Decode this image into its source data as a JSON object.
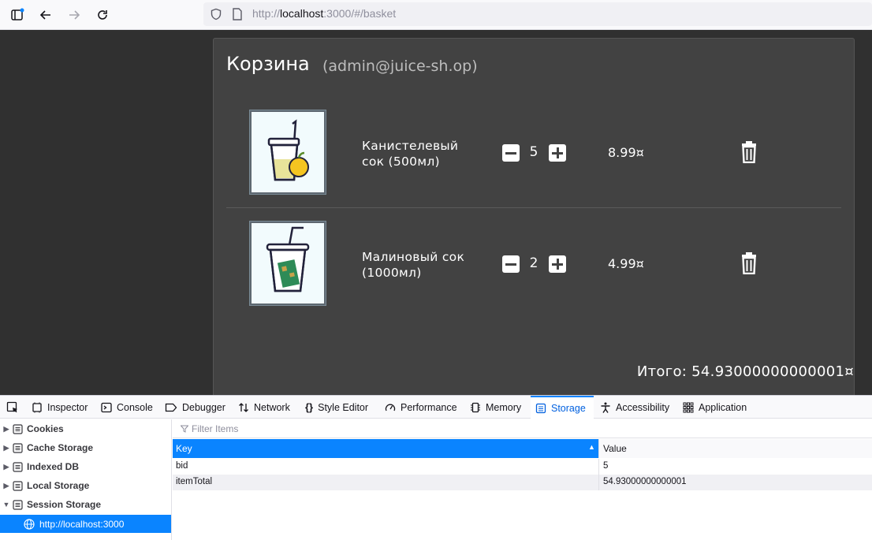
{
  "browser": {
    "url_prefix": "http://",
    "url_host": "localhost",
    "url_rest": ":3000/#/basket"
  },
  "basket": {
    "title": "Корзина",
    "user": "(admin@juice-sh.op)",
    "items": [
      {
        "name": "Канистелевый сок (500мл)",
        "quantity": "5",
        "price": "8.99¤"
      },
      {
        "name": "Малиновый сок (1000мл)",
        "quantity": "2",
        "price": "4.99¤"
      }
    ],
    "total": "Итого: 54.93000000000001¤"
  },
  "devtools": {
    "tabs": [
      {
        "label": "Inspector",
        "icon": "inspector-icon"
      },
      {
        "label": "Console",
        "icon": "console-icon"
      },
      {
        "label": "Debugger",
        "icon": "debugger-icon"
      },
      {
        "label": "Network",
        "icon": "network-icon"
      },
      {
        "label": "Style Editor",
        "icon": "braces-icon"
      },
      {
        "label": "Performance",
        "icon": "gauge-icon"
      },
      {
        "label": "Memory",
        "icon": "chip-icon"
      },
      {
        "label": "Storage",
        "icon": "storage-icon",
        "active": true
      },
      {
        "label": "Accessibility",
        "icon": "accessibility-icon"
      },
      {
        "label": "Application",
        "icon": "grid-icon"
      }
    ],
    "sidebar": [
      {
        "label": "Cookies",
        "expanded": false
      },
      {
        "label": "Cache Storage",
        "expanded": false
      },
      {
        "label": "Indexed DB",
        "expanded": false
      },
      {
        "label": "Local Storage",
        "expanded": false
      },
      {
        "label": "Session Storage",
        "expanded": true
      }
    ],
    "selected_origin": "http://localhost:3000",
    "filter_placeholder": "Filter Items",
    "table": {
      "columns": [
        "Key",
        "Value"
      ],
      "rows": [
        {
          "key": "bid",
          "value": "5"
        },
        {
          "key": "itemTotal",
          "value": "54.93000000000001"
        }
      ]
    }
  },
  "colors": {
    "page_bg": "#303030",
    "card_bg": "#424242",
    "accent": "#0a84ff"
  }
}
